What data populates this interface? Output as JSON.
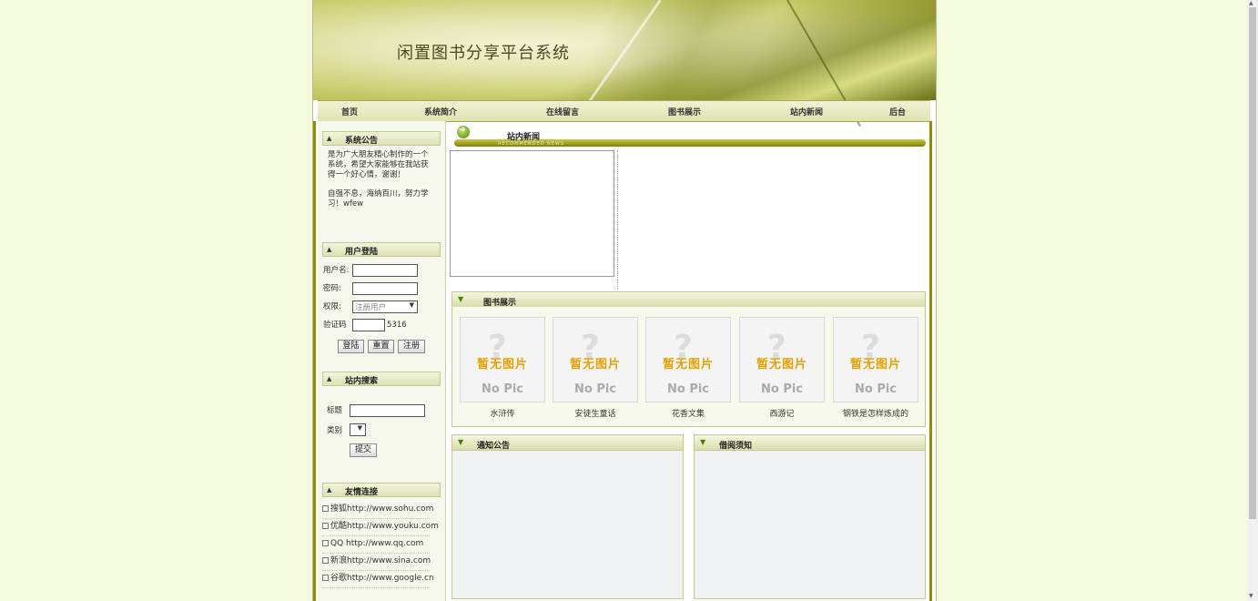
{
  "header": {
    "title": "闲置图书分享平台系统"
  },
  "nav": [
    "首页",
    "系统简介",
    "在线留言",
    "图书展示",
    "站内新闻",
    "后台"
  ],
  "sidebar": {
    "announcement": {
      "title": "系统公告",
      "para1": "是为广大朋友精心制作的一个系统，希望大家能够在我站获得一个好心情，谢谢！",
      "para2": "自强不息，海纳百川，努力学习！wfew"
    },
    "login": {
      "title": "用户登陆",
      "username_label": "用户名:",
      "password_label": "密码:",
      "role_label": "权限:",
      "role_value": "注册用户",
      "captcha_label": "验证码",
      "captcha_code": "5316",
      "login_btn": "登陆",
      "reset_btn": "重置",
      "register_btn": "注册"
    },
    "search": {
      "title": "站内搜索",
      "title_label": "标题",
      "category_label": "类别",
      "submit_btn": "提交"
    },
    "links": {
      "title": "友情连接",
      "items": [
        "搜狐http://www.sohu.com",
        "优酷http://www.youku.com",
        "QQ http://www.qq.com",
        "新浪http://www.sina.com",
        "谷歌http://www.google.cn"
      ]
    }
  },
  "news": {
    "title": "站内新闻",
    "subtitle": "RECOMMENDED NEWS"
  },
  "books": {
    "title": "图书展示",
    "placeholder_cn": "暂无图片",
    "placeholder_en": "No Pic",
    "items": [
      "水浒传",
      "安徒生童话",
      "花香文集",
      "西游记",
      "钢铁是怎样炼成的"
    ]
  },
  "notice": {
    "title": "通知公告"
  },
  "borrow": {
    "title": "借阅须知"
  }
}
